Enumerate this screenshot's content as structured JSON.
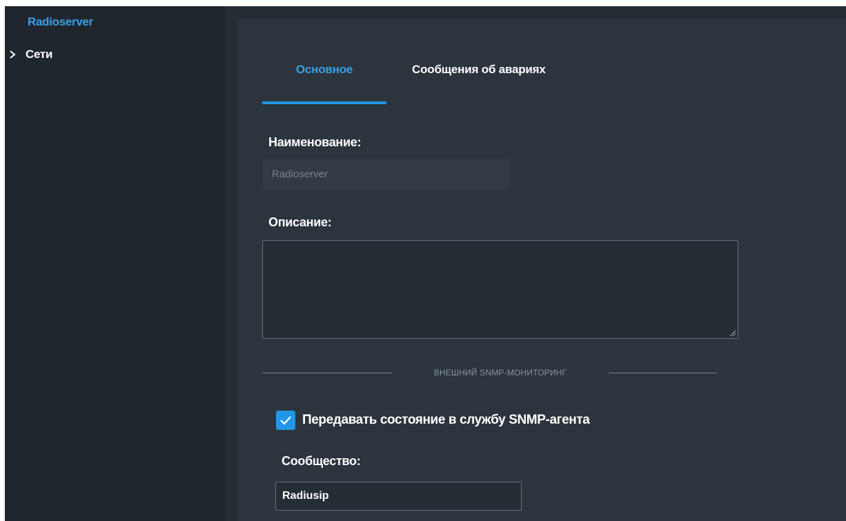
{
  "sidebar": {
    "root_label": "Radioserver",
    "items": [
      {
        "label": "Сети",
        "icon": "chevron-right-icon"
      }
    ]
  },
  "tabs": [
    {
      "label": "Основное",
      "active": true
    },
    {
      "label": "Сообщения об авариях",
      "active": false
    }
  ],
  "form": {
    "name_label": "Наименование:",
    "name_value": "Radioserver",
    "description_label": "Описание:",
    "description_value": "",
    "section_title": "ВНЕШНИЙ SNMP-МОНИТОРИНГ",
    "snmp_checkbox_label": "Передавать состояние в службу SNMP-агента",
    "snmp_checkbox_checked": true,
    "community_label": "Сообщество:",
    "community_value": "Radiusip"
  },
  "colors": {
    "accent": "#2196e8",
    "panel_bg": "#2c343d",
    "sidebar_bg": "#20262d"
  }
}
